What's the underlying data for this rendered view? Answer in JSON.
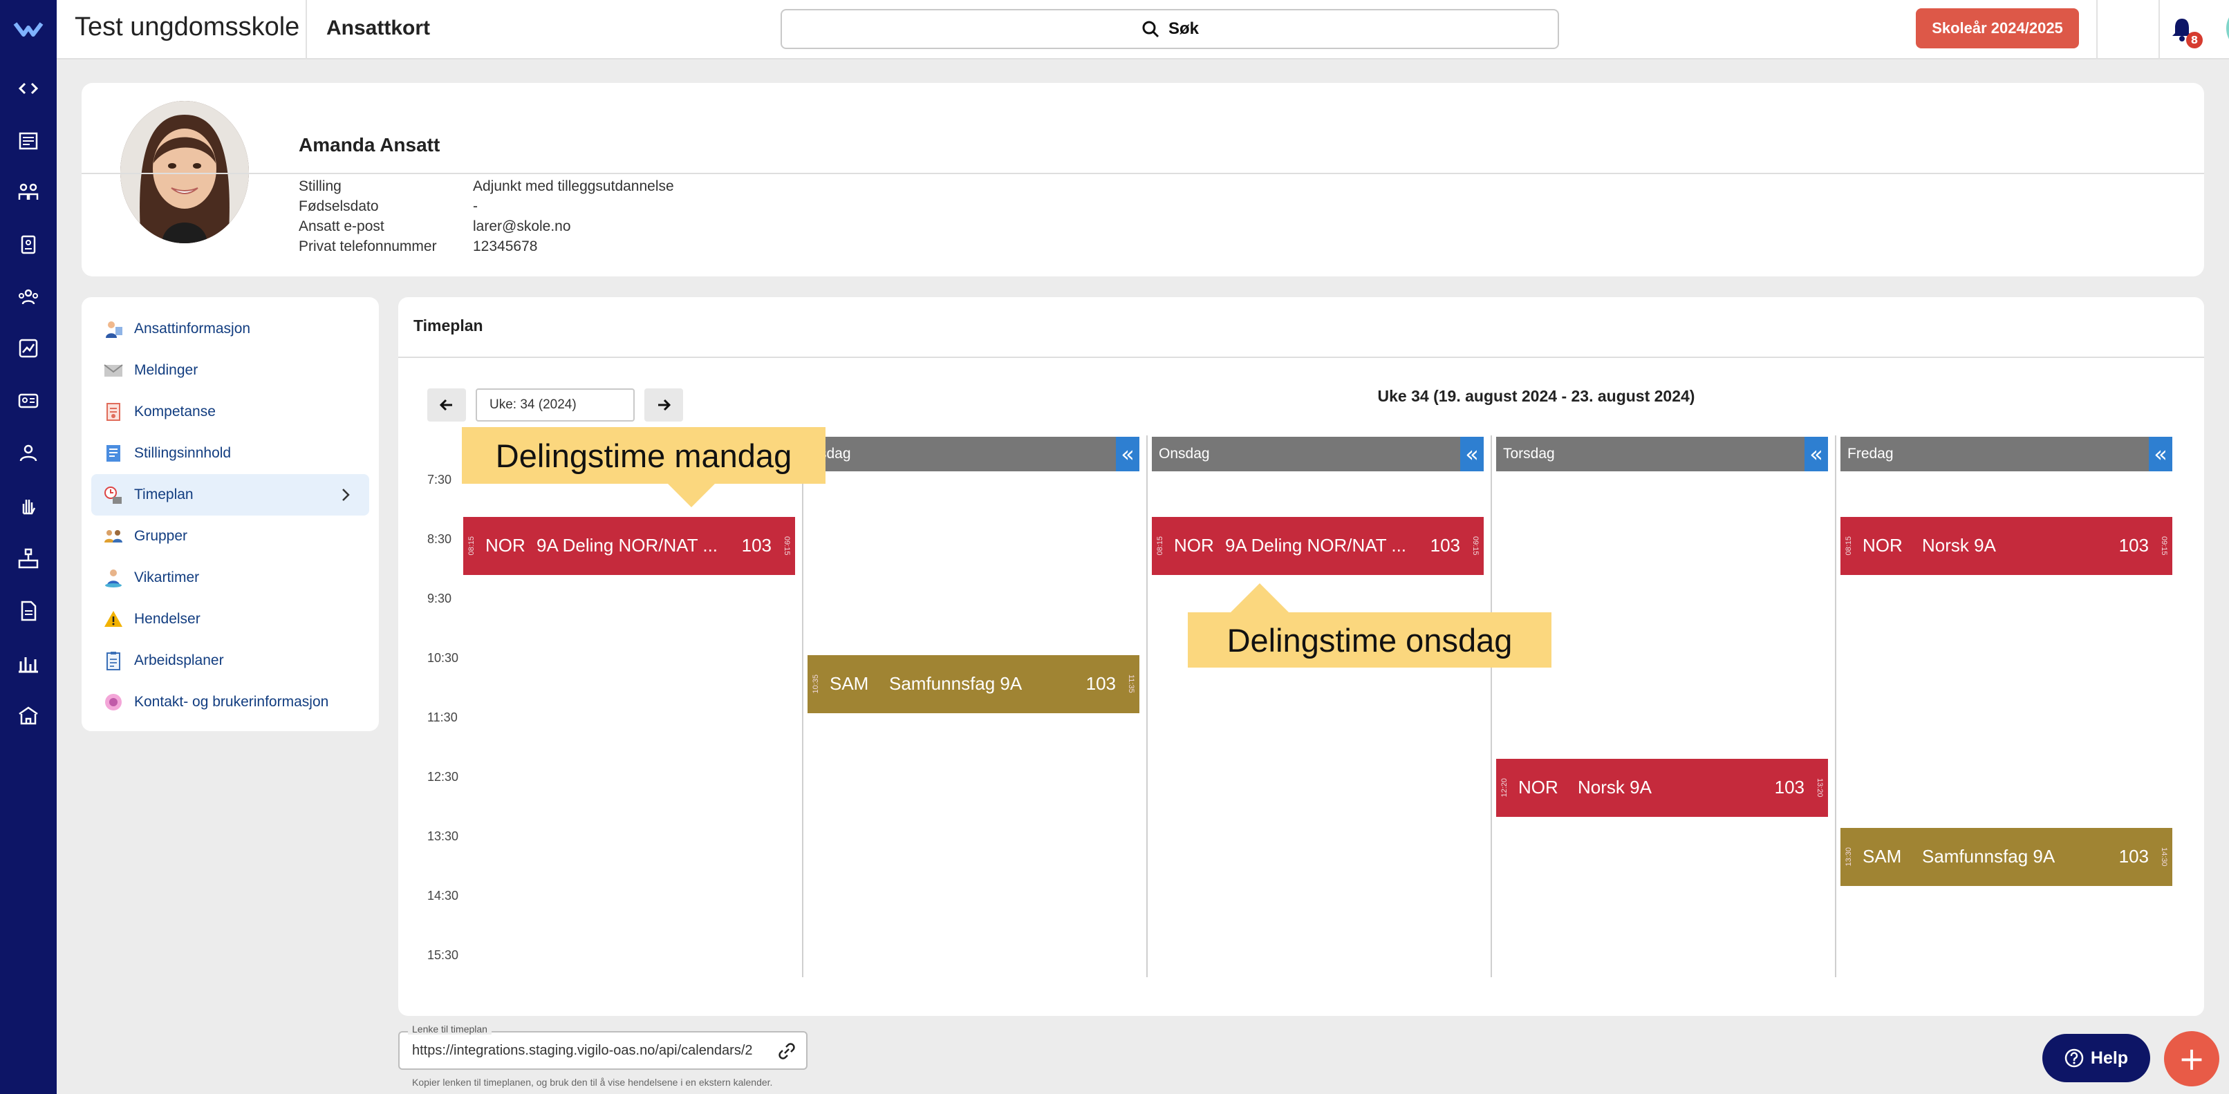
{
  "topbar": {
    "school_name": "Test ungdomsskole",
    "breadcrumb": "Ansattkort",
    "search_label": "Søk",
    "school_year_button": "Skoleår 2024/2025",
    "notification_count": "8"
  },
  "rail": {
    "icons": [
      "code-icon",
      "news-icon",
      "students-icon",
      "badge-icon",
      "groups-icon",
      "chart-icon",
      "id-card-icon",
      "user-icon",
      "hand-icon",
      "org-icon",
      "document-icon",
      "stats-icon",
      "building-icon"
    ]
  },
  "profile": {
    "name": "Amanda Ansatt",
    "fields": [
      {
        "label": "Stilling",
        "value": "Adjunkt med tilleggsutdannelse"
      },
      {
        "label": "Fødselsdato",
        "value": "-"
      },
      {
        "label": "Ansatt e-post",
        "value": "larer@skole.no"
      },
      {
        "label": "Privat telefonnummer",
        "value": "12345678"
      }
    ]
  },
  "menu": {
    "items": [
      {
        "label": "Ansattinformasjon",
        "icon": "employee-info-icon"
      },
      {
        "label": "Meldinger",
        "icon": "envelope-icon"
      },
      {
        "label": "Kompetanse",
        "icon": "certificate-icon"
      },
      {
        "label": "Stillingsinnhold",
        "icon": "position-content-icon"
      },
      {
        "label": "Timeplan",
        "icon": "schedule-icon",
        "active": true
      },
      {
        "label": "Grupper",
        "icon": "group-icon"
      },
      {
        "label": "Vikartimer",
        "icon": "substitute-icon"
      },
      {
        "label": "Hendelser",
        "icon": "warning-icon"
      },
      {
        "label": "Arbeidsplaner",
        "icon": "clipboard-icon"
      },
      {
        "label": "Kontakt- og brukerinformasjon",
        "icon": "contact-icon"
      }
    ]
  },
  "timeplan": {
    "title": "Timeplan",
    "week_input": "Uke: 34 (2024)",
    "week_title": "Uke 34 (19. august 2024 - 23. august 2024)",
    "times": [
      "7:30",
      "8:30",
      "9:30",
      "10:30",
      "11:30",
      "12:30",
      "13:30",
      "14:30",
      "15:30"
    ],
    "days": [
      "rsdag",
      "Onsdag",
      "Torsdag",
      "Fredag"
    ],
    "collapse_glyph": "«",
    "lessons": [
      {
        "code": "NOR",
        "subject": "9A Deling NOR/NAT ...",
        "room": "103",
        "start": "08:15",
        "end": "09:15"
      },
      {
        "code": "SAM",
        "subject": "Samfunnsfag 9A",
        "room": "103",
        "start": "10:35",
        "end": "11:35"
      },
      {
        "code": "NOR",
        "subject": "9A Deling NOR/NAT ...",
        "room": "103",
        "start": "08:15",
        "end": "09:15"
      },
      {
        "code": "NOR",
        "subject": "Norsk 9A",
        "room": "103",
        "start": "12:20",
        "end": "13:20"
      },
      {
        "code": "NOR",
        "subject": "Norsk 9A",
        "room": "103",
        "start": "08:15",
        "end": "09:15"
      },
      {
        "code": "SAM",
        "subject": "Samfunnsfag 9A",
        "room": "103",
        "start": "13:30",
        "end": "14:30"
      }
    ],
    "callouts": {
      "monday": "Delingstime mandag",
      "wednesday": "Delingstime onsdag"
    }
  },
  "link": {
    "legend": "Lenke til timeplan",
    "value": "https://integrations.staging.vigilo-oas.no/api/calendars/2",
    "hint": "Kopier lenken til timeplanen, og bruk den til å vise hendelsene i en ekstern kalender."
  },
  "help_button": "Help",
  "fab_glyph": "+"
}
